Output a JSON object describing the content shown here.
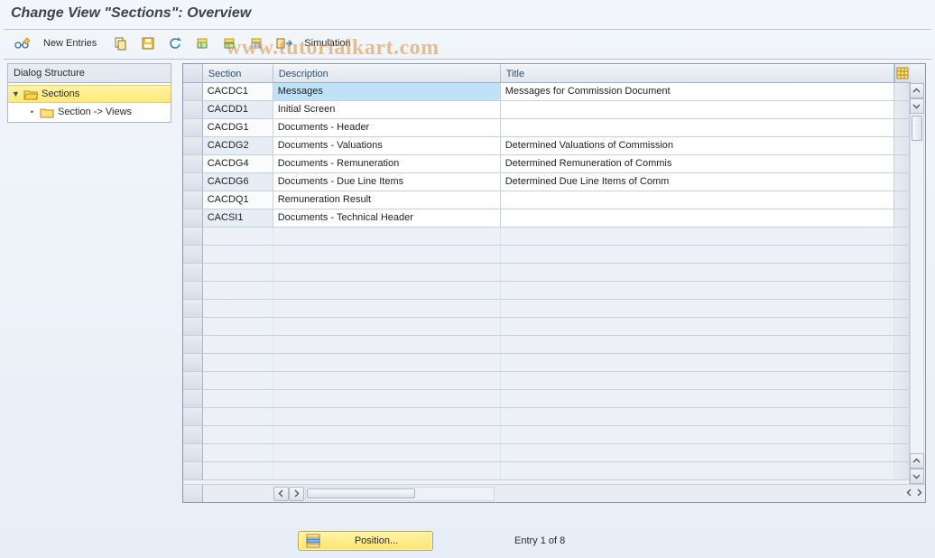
{
  "title": "Change View \"Sections\": Overview",
  "watermark": "www.tutorialkart.com",
  "toolbar": {
    "new_entries_label": "New Entries",
    "simulation_label": "Simulation"
  },
  "tree": {
    "header": "Dialog Structure",
    "items": [
      {
        "label": "Sections",
        "selected": true,
        "open": true
      },
      {
        "label": "Section -> Views",
        "selected": false,
        "open": false
      }
    ]
  },
  "table": {
    "columns": {
      "section": "Section",
      "description": "Description",
      "title": "Title"
    },
    "rows": [
      {
        "section": "CACDC1",
        "description": "Messages",
        "title": "Messages for Commission Document"
      },
      {
        "section": "CACDD1",
        "description": "Initial Screen",
        "title": ""
      },
      {
        "section": "CACDG1",
        "description": "Documents - Header",
        "title": ""
      },
      {
        "section": "CACDG2",
        "description": "Documents - Valuations",
        "title": "Determined Valuations of Commission"
      },
      {
        "section": "CACDG4",
        "description": "Documents - Remuneration",
        "title": "Determined Remuneration of Commis"
      },
      {
        "section": "CACDG6",
        "description": "Documents - Due Line Items",
        "title": "Determined Due Line Items of Comm"
      },
      {
        "section": "CACDQ1",
        "description": "Remuneration Result",
        "title": ""
      },
      {
        "section": "CACSI1",
        "description": "Documents - Technical Header",
        "title": ""
      }
    ],
    "empty_rows": 14
  },
  "footer": {
    "position_button": "Position...",
    "entry_status": "Entry 1 of 8"
  }
}
